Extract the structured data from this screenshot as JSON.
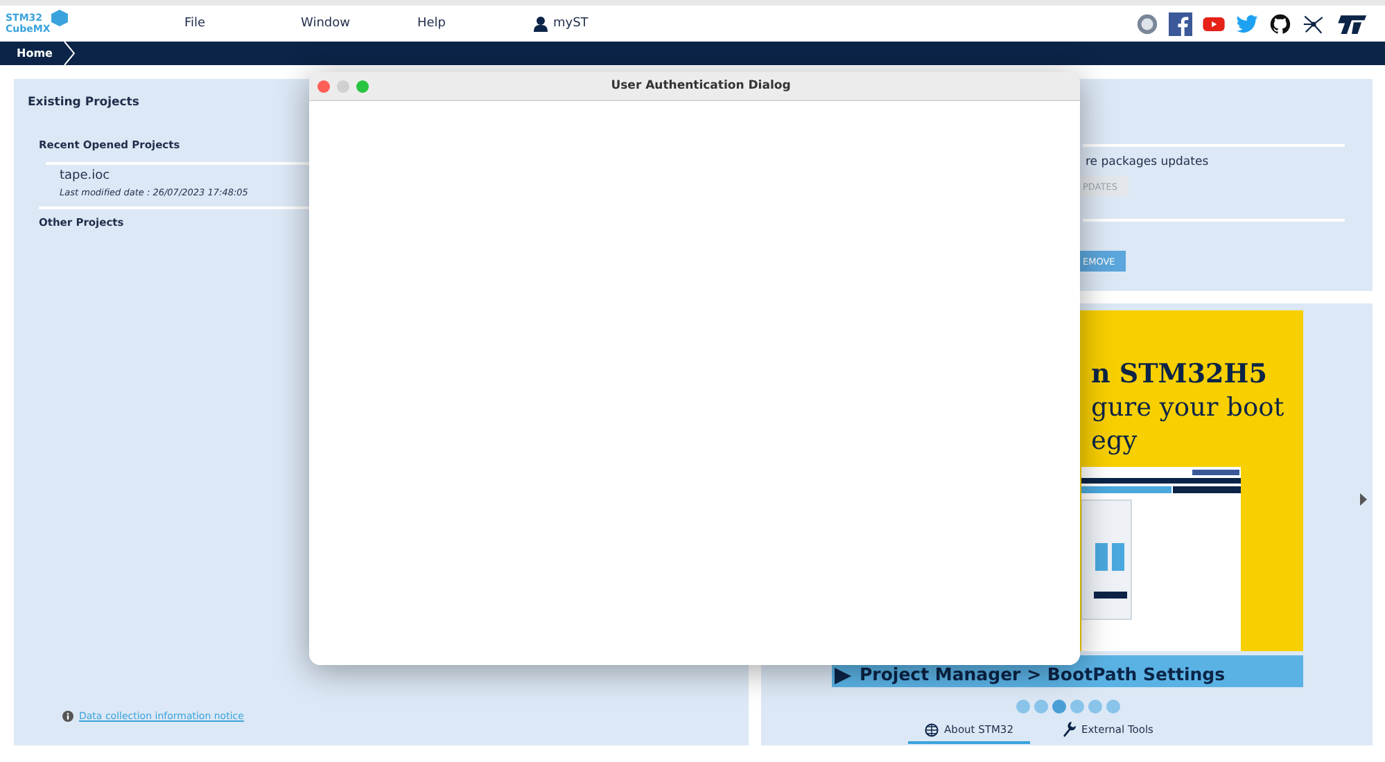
{
  "app": {
    "logo": {
      "line1": "STM32",
      "line2": "CubeMX"
    },
    "menu": [
      {
        "label": "File"
      },
      {
        "label": "Window"
      },
      {
        "label": "Help"
      }
    ],
    "account": "myST"
  },
  "breadcrumb": [
    {
      "label": "Home"
    }
  ],
  "existing_projects": {
    "title": "Existing Projects",
    "recent_title": "Recent Opened Projects",
    "recent": [
      {
        "name": "tape.ioc",
        "modified": "Last modified date : 26/07/2023 17:48:05"
      }
    ],
    "other_title": "Other Projects",
    "notice_link": "Data collection information notice"
  },
  "updates": {
    "heading": "re packages updates",
    "buttons": [
      {
        "label": "PDATES",
        "disabled": true
      },
      {
        "label": "EMOVE",
        "disabled": false
      }
    ]
  },
  "banner": {
    "line1": "n STM32H5",
    "line2": "gure your boot",
    "line3": "egy",
    "footer": "Project Manager > BootPath Settings"
  },
  "carousel_dots": [
    {
      "selected": false
    },
    {
      "selected": false
    },
    {
      "selected": true
    },
    {
      "selected": false
    },
    {
      "selected": false
    },
    {
      "selected": false
    }
  ],
  "tabs": [
    {
      "label": "About STM32",
      "selected": true
    },
    {
      "label": "External Tools",
      "selected": false
    }
  ],
  "dialog": {
    "title": "User Authentication Dialog"
  }
}
